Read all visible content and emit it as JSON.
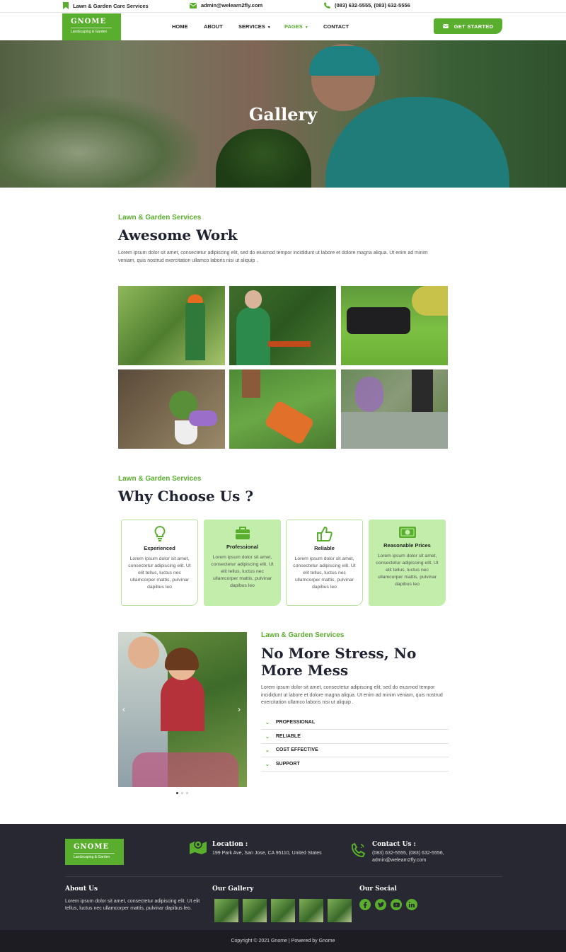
{
  "topbar": {
    "tagline": "Lawn & Garden Care Services",
    "email": "admin@welearn2fly.com",
    "phone": "(083) 632-5555, (083) 632-5556",
    "icons": [
      "bookmark-icon",
      "envelope-icon",
      "phone-icon"
    ]
  },
  "brand": {
    "name": "GNOME",
    "subtitle": "Landscaping & Garden",
    "accent": "#5aae2e"
  },
  "nav": {
    "items": [
      {
        "label": "HOME"
      },
      {
        "label": "ABOUT"
      },
      {
        "label": "SERVICES"
      },
      {
        "label": "PAGES"
      },
      {
        "label": "CONTACT"
      }
    ],
    "active": "PAGES",
    "cta_label": "GET STARTED"
  },
  "hero": {
    "title": "Gallery"
  },
  "gallery_section": {
    "kicker": "Lawn & Garden Services",
    "title": "Awesome Work",
    "text": "Lorem ipsum dolor sit amet, consectetur adipiscing elit, sed do eiusmod tempor incididunt ut labore et dolore magna aliqua. Ut enim ad minim veniam, quis nostrud exercitation ullamco laboris nisi ut aliquip ."
  },
  "why_section": {
    "kicker": "Lawn & Garden Services",
    "title": "Why Choose Us ?",
    "cards": [
      {
        "title": "Experienced",
        "icon": "lightbulb-icon",
        "text": "Lorem ipsum dolor sit amet, consectetur adipiscing elit. Ut elit tellus, luctus nec ullamcorper mattis, pulvinar dapibus leo"
      },
      {
        "title": "Professional",
        "icon": "briefcase-icon",
        "text": "Lorem ipsum dolor sit amet, consectetur adipiscing elit. Ut elit tellus, luctus nec ullamcorper mattis, pulvinar dapibus leo"
      },
      {
        "title": "Reliable",
        "icon": "thumbs-up-icon",
        "text": "Lorem ipsum dolor sit amet, consectetur adipiscing elit. Ut elit tellus, luctus nec ullamcorper mattis, pulvinar dapibus leo"
      },
      {
        "title": "Reasonable Prices",
        "icon": "money-icon",
        "text": "Lorem ipsum dolor sit amet, consectetur adipiscing elit. Ut elit tellus, luctus nec ullamcorper mattis, pulvinar dapibus leo"
      }
    ]
  },
  "stress_section": {
    "kicker": "Lawn & Garden Services",
    "title": "No More Stress, No More Mess",
    "text": "Lorem ipsum dolor sit amet, consectetur adipiscing elit, sed do eiusmod tempor incididunt ut labore et dolore magna aliqua. Ut enim ad minim veniam, quis nostrud exercitation ullamco laboris nisi ut aliquip .",
    "accordion": [
      "PROFESSIONAL",
      "RELIABLE",
      "COST EFFECTIVE",
      "SUPPORT"
    ],
    "slider_prev": "‹",
    "slider_next": "›"
  },
  "footer": {
    "brand_name": "GNOME",
    "brand_subtitle": "Landscaping & Garden",
    "location_title": "Location :",
    "location_text": "199 Park Ave, San Jose, CA 95110, United States",
    "contact_title": "Contact Us :",
    "contact_phone": "(083) 632-5555, (083) 632-5556,",
    "contact_email": "admin@welearn2fly.com",
    "about_title": "About Us",
    "about_text": "Lorem ipsum dolor sit amet, consectetur adipiscing elit. Ut elit tellus, luctus nec ullamcorper mattis, pulvinar dapibus leo.",
    "gallery_title": "Our Gallery",
    "social_title": "Our Social",
    "social": [
      "facebook-icon",
      "twitter-icon",
      "youtube-icon",
      "linkedin-icon"
    ],
    "copyright": "Copyright © 2021 Gnome | Powered by Gnome"
  }
}
